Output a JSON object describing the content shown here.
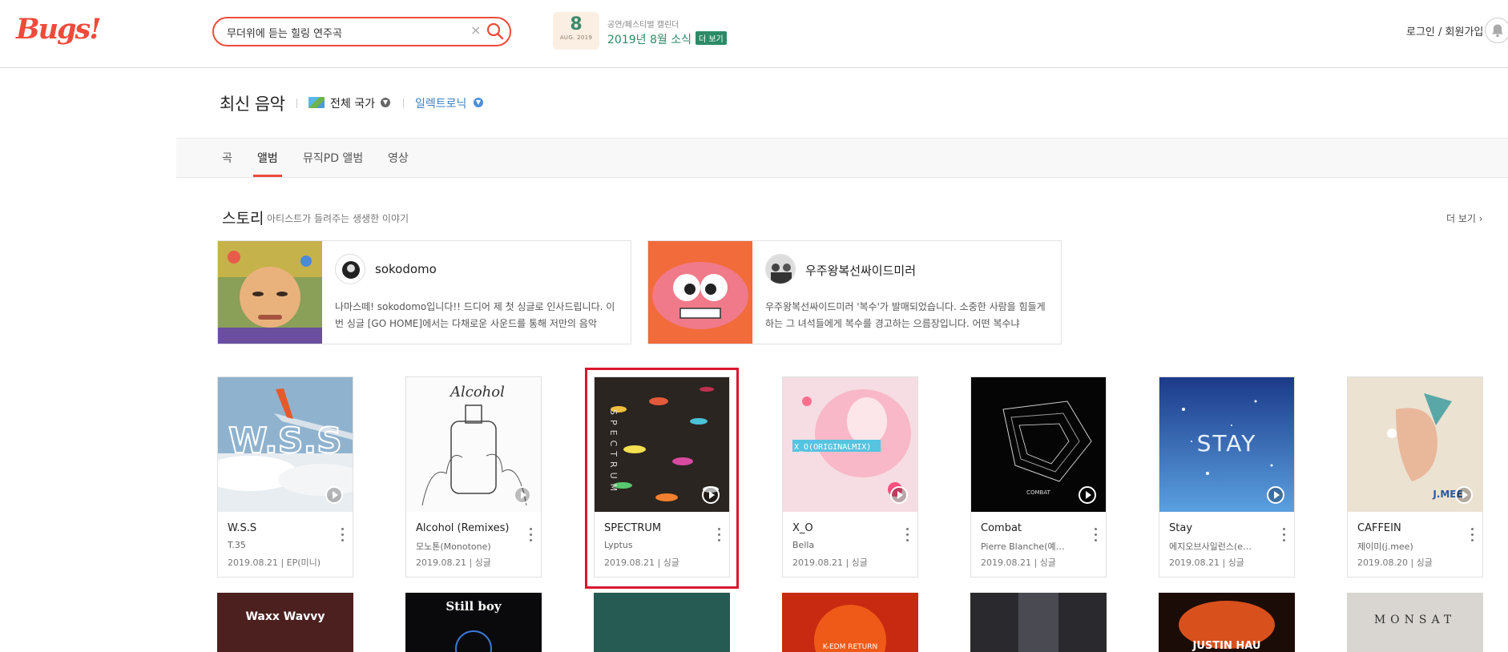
{
  "brand": {
    "logo": "Bugs!",
    "accent": "#ee4b3b"
  },
  "search": {
    "value": "무더위에 듣는 힐링 연주곡",
    "placeholder": ""
  },
  "calendar": {
    "day": "8",
    "month": "AUG. 2019",
    "caption": "공연/페스티벌 캘린더",
    "news": "2019년 8월 소식",
    "more": "더 보기"
  },
  "auth": {
    "login": "로그인 / 회원가입"
  },
  "page": {
    "title": "최신 음악",
    "country_filter": "전체 국가",
    "genre_filter": "일렉트로닉"
  },
  "tabs": [
    {
      "label": "곡",
      "active": false
    },
    {
      "label": "앨범",
      "active": true
    },
    {
      "label": "뮤직PD 앨범",
      "active": false
    },
    {
      "label": "영상",
      "active": false
    }
  ],
  "story": {
    "title": "스토리",
    "subtitle": "아티스트가 들려주는 생생한 이야기",
    "more": "더 보기 ›",
    "cards": [
      {
        "name": "sokodomo",
        "text": "나마스떼! sokodomo입니다!! 드디어 제 첫 싱글로 인사드립니다. 이번 싱글 [GO HOME]에서는 다채로운 사운드를 통해 저만의 음악"
      },
      {
        "name": "우주왕복선싸이드미러",
        "text": "우주왕복선싸이드미러 '복수'가 발매되었습니다. 소중한 사람을 힘들게 하는 그 녀석들에게 복수를 경고하는 으름장입니다. 어떤 복수냐"
      }
    ]
  },
  "albums": [
    {
      "title": "W.S.S",
      "artist": "T.35",
      "meta": "2019.08.21 | EP(미니)",
      "cover_text": "W.S.S"
    },
    {
      "title": "Alcohol (Remixes)",
      "artist": "모노톤(Monotone)",
      "meta": "2019.08.21 | 싱글",
      "cover_text": "Alcohol"
    },
    {
      "title": "SPECTRUM",
      "artist": "Lyptus",
      "meta": "2019.08.21 | 싱글",
      "cover_text": "SPECTRUM"
    },
    {
      "title": "X_O",
      "artist": "Bella",
      "meta": "2019.08.21 | 싱글",
      "cover_text": "X_O(ORIGINALMIX)"
    },
    {
      "title": "Combat",
      "artist": "Pierre Blanche(예…",
      "meta": "2019.08.21 | 싱글",
      "cover_text": "COMBAT"
    },
    {
      "title": "Stay",
      "artist": "에지오브사일런스(e…",
      "meta": "2019.08.21 | 싱글",
      "cover_text": "STAY"
    },
    {
      "title": "CAFFEIN",
      "artist": "제이미(j.mee)",
      "meta": "2019.08.20 | 싱글",
      "cover_text": "J.MEE"
    }
  ],
  "albums_row2": [
    {
      "cover_text": "Waxx Wavvy"
    },
    {
      "cover_text": "Still boy"
    },
    {
      "cover_text": ""
    },
    {
      "cover_text": "K-EDM RETURN"
    },
    {
      "cover_text": ""
    },
    {
      "cover_text": "JUSTIN HAU"
    },
    {
      "cover_text": "MONSAT"
    }
  ]
}
